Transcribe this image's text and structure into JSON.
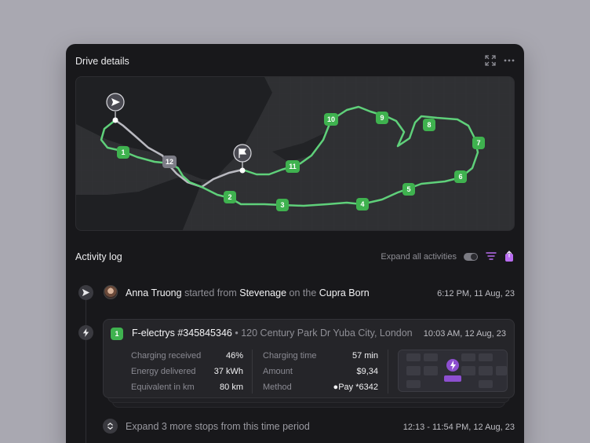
{
  "panel": {
    "title": "Drive details"
  },
  "header_icons": [
    "expand-icon",
    "more-icon"
  ],
  "map": {
    "start_marker": "send-icon",
    "end_marker": "flag-icon",
    "stops": [
      "1",
      "2",
      "3",
      "4",
      "5",
      "6",
      "7",
      "8",
      "9",
      "10",
      "11",
      "12"
    ],
    "colors": {
      "route": "#5fd07a",
      "stop": "#3fb24f",
      "past_route": "#b9b9c0",
      "stop_12": "#7c7c86"
    }
  },
  "activity": {
    "title": "Activity log",
    "expand_all_label": "Expand all activities",
    "events": [
      {
        "user": "Anna Truong",
        "verb": "started from",
        "place": "Stevenage",
        "conj": "on the",
        "vehicle": "Cupra Born",
        "time": "6:12 PM, 11 Aug, 23"
      }
    ],
    "charge": {
      "badge": "1",
      "station": "F-electrys #345845346",
      "separator": "•",
      "address": "120 Century Park Dr Yuba City, London",
      "time": "10:03 AM, 12 Aug, 23",
      "left": [
        {
          "label": "Charging received",
          "value": "46%"
        },
        {
          "label": "Energy delivered",
          "value": "37 kWh"
        },
        {
          "label": "Equivalent in km",
          "value": "80 km"
        }
      ],
      "right": [
        {
          "label": "Charging time",
          "value": "57 min"
        },
        {
          "label": "Amount",
          "value": "$9,34"
        },
        {
          "label": "Method",
          "value_brand": "Pay",
          "value": "*6342"
        }
      ]
    },
    "more": {
      "label": "Expand 3 more stops from this time period",
      "time": "12:13 - 11:54 PM, 12 Aug, 23"
    }
  }
}
